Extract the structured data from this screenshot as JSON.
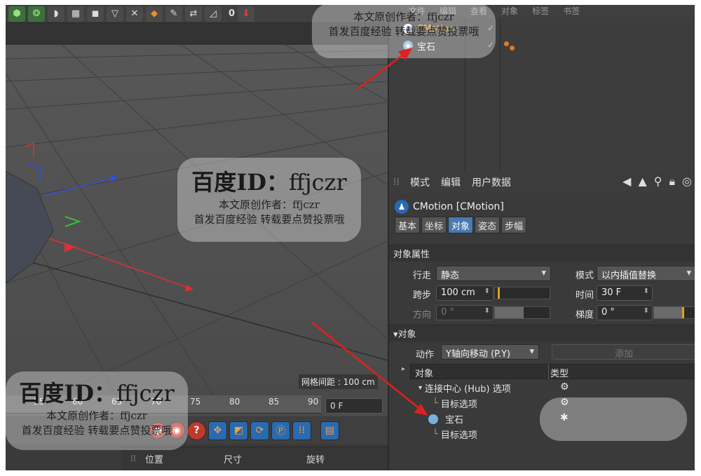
{
  "toolbar": {
    "frame_value": "0"
  },
  "om_menu": [
    "文件",
    "编辑",
    "查看",
    "对象",
    "标签",
    "书签"
  ],
  "objects": [
    {
      "name": "CMotion",
      "icon": "walker-icon"
    },
    {
      "name": "宝石",
      "icon": "gem-icon"
    }
  ],
  "viewport": {
    "grid_distance": "网格间距 : 100 cm"
  },
  "timeline": {
    "ticks": [
      "55",
      "60",
      "65",
      "70",
      "75",
      "80",
      "85",
      "90"
    ],
    "frame_field": "0 F"
  },
  "coords": {
    "position": "位置",
    "size": "尺寸",
    "rotation": "旋转"
  },
  "attributes": {
    "menu": [
      "模式",
      "编辑",
      "用户数据"
    ],
    "title": "CMotion [CMotion]",
    "tabs": [
      "基本",
      "坐标",
      "对象",
      "姿态",
      "步幅"
    ],
    "active_tab": "对象",
    "section_object_props": "对象属性",
    "walk_label": "行走",
    "walk_value": "静态",
    "mode_label": "模式",
    "mode_value": "以内插值替换",
    "stride_label": "跨步",
    "stride_value": "100 cm",
    "time_label": "时间",
    "time_value": "30 F",
    "direction_label": "方向",
    "direction_value": "0 °",
    "slope_label": "梯度",
    "slope_value": "0 °",
    "section_object": "▾对象",
    "action_label": "动作",
    "action_value": "Y轴向移动 (P.Y)",
    "add_button": "添加",
    "tree_col_object": "对象",
    "tree_col_type": "类型",
    "tree_rows": [
      "连接中心 (Hub) 选项",
      "目标选项",
      "宝石",
      "目标选项"
    ]
  },
  "watermarks": {
    "id_line_prefix": "百度ID：",
    "id_line_name": "ffjczr",
    "author_line": "本文原创作者：ffjczr",
    "promo_line": "首发百度经验  转载要点赞投票哦"
  },
  "colors": {
    "accent_blue": "#4a78b0",
    "arrow_red": "#e0201c",
    "check_green": "#6fd16f",
    "tag_orange": "#e07a20"
  }
}
